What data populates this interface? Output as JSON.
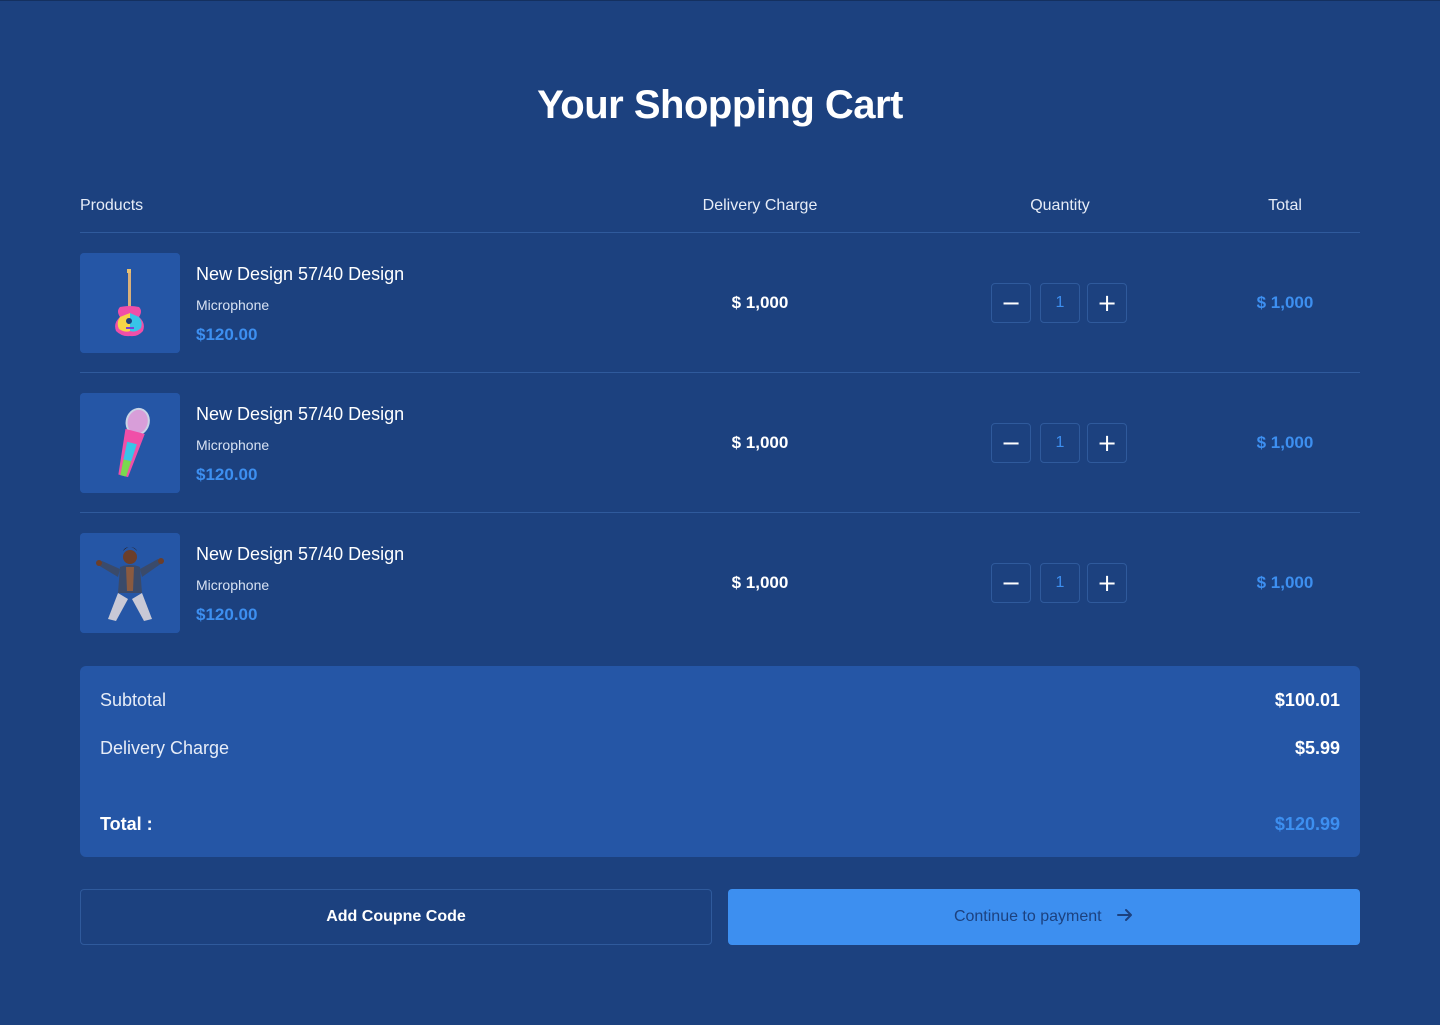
{
  "page": {
    "title": "Your Shopping Cart"
  },
  "table": {
    "headers": {
      "products": "Products",
      "delivery": "Delivery Charge",
      "quantity": "Quantity",
      "total": "Total"
    },
    "rows": [
      {
        "name": "New Design 57/40 Design",
        "category": "Microphone",
        "price": "$120.00",
        "delivery": "$ 1,000",
        "quantity": "1",
        "total": "$ 1,000",
        "image": "guitar-image"
      },
      {
        "name": "New Design 57/40 Design",
        "category": "Microphone",
        "price": "$120.00",
        "delivery": "$ 1,000",
        "quantity": "1",
        "total": "$ 1,000",
        "image": "microphone-image"
      },
      {
        "name": "New Design 57/40 Design",
        "category": "Microphone",
        "price": "$120.00",
        "delivery": "$ 1,000",
        "quantity": "1",
        "total": "$ 1,000",
        "image": "performer-image"
      }
    ],
    "qty_icons": {
      "decrease": "minus-icon",
      "increase": "plus-icon"
    }
  },
  "summary": {
    "subtotal_label": "Subtotal",
    "subtotal_value": "$100.01",
    "delivery_label": "Delivery Charge",
    "delivery_value": "$5.99",
    "total_label": "Total :",
    "total_value": "$120.99"
  },
  "actions": {
    "coupon_label": "Add Coupne Code",
    "pay_label": "Continue to payment",
    "pay_icon": "arrow-right-icon"
  },
  "colors": {
    "background": "#1c417f",
    "panel": "#2556a6",
    "accent": "#3d8ff0",
    "divider": "#2f5a9c"
  }
}
